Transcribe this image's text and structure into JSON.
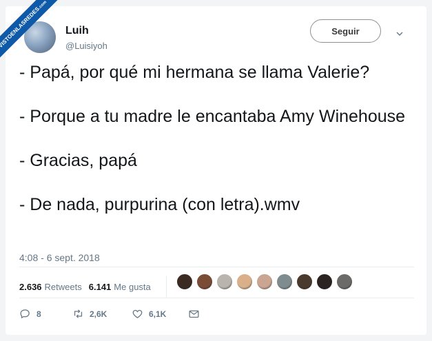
{
  "watermark": {
    "text": "VISTOENLASREDES",
    "suffix": ".com"
  },
  "user": {
    "name": "Luih",
    "handle": "@Luisiyoh"
  },
  "follow_label": "Seguir",
  "tweet": {
    "lines": [
      "- Papá, por qué mi hermana se llama Valerie?",
      "- Porque a tu madre le encantaba Amy Winehouse",
      "- Gracias, papá",
      "- De nada, purpurina (con letra).wmv"
    ],
    "timestamp": "4:08 - 6 sept. 2018"
  },
  "stats": {
    "retweets_count": "2.636",
    "retweets_label": "Retweets",
    "likes_count": "6.141",
    "likes_label": "Me gusta"
  },
  "liker_avatar_colors": [
    "#3b2a22",
    "#7a4b35",
    "#b9b4ad",
    "#d9b08a",
    "#c9a592",
    "#7e8c90",
    "#4a3a2e",
    "#2b2222",
    "#6b6a68"
  ],
  "actions": {
    "replies": "8",
    "retweets": "2,6K",
    "likes": "6,1K"
  }
}
